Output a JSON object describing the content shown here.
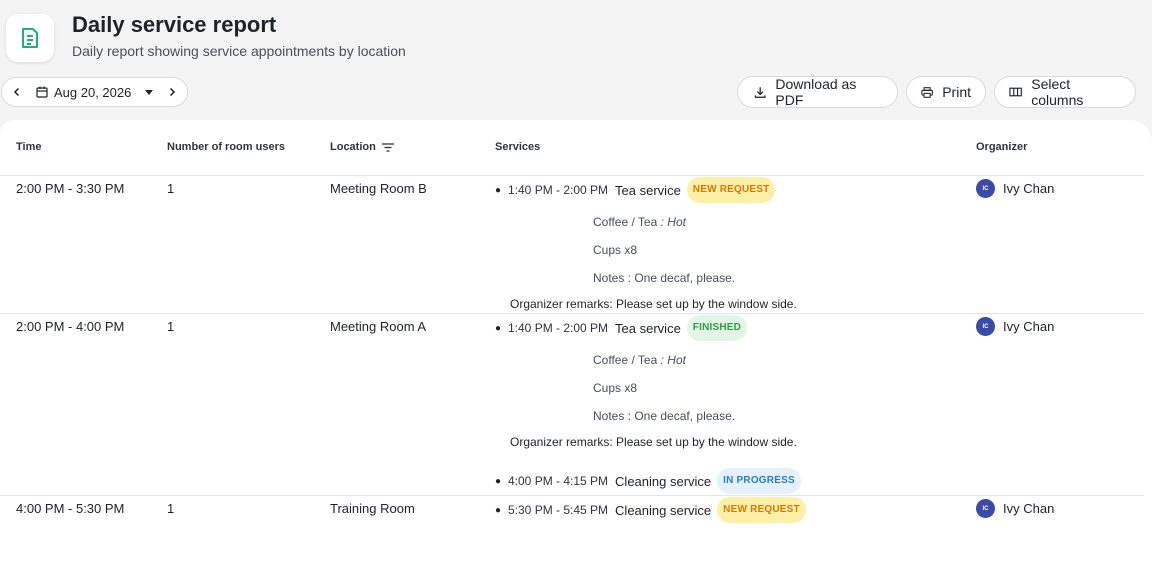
{
  "header": {
    "title": "Daily service report",
    "subtitle": "Daily report showing service appointments by location"
  },
  "date_nav": {
    "date": "Aug 20, 2026"
  },
  "toolbar": {
    "download_label": "Download as PDF",
    "print_label": "Print",
    "columns_label": "Select columns"
  },
  "columns": {
    "time": "Time",
    "users": "Number of room users",
    "location": "Location",
    "services": "Services",
    "organizer": "Organizer"
  },
  "rows": [
    {
      "time": "2:00 PM - 3:30 PM",
      "users": "1",
      "location": "Meeting Room B",
      "organizer": {
        "initials": "IC",
        "name": "Ivy Chan"
      },
      "services": [
        {
          "time": "1:40 PM - 2:00 PM",
          "name": "Tea service",
          "status": "NEW REQUEST",
          "details": {
            "coffee_label": "Coffee / Tea",
            "coffee_value": ": Hot",
            "cups": "Cups x8",
            "notes": "Notes : One decaf, please."
          },
          "remarks": "Organizer remarks: Please set up by the window side."
        }
      ]
    },
    {
      "time": "2:00 PM - 4:00 PM",
      "users": "1",
      "location": "Meeting Room A",
      "organizer": {
        "initials": "IC",
        "name": "Ivy Chan"
      },
      "services": [
        {
          "time": "1:40 PM - 2:00 PM",
          "name": "Tea service",
          "status": "FINISHED",
          "details": {
            "coffee_label": "Coffee / Tea",
            "coffee_value": ": Hot",
            "cups": "Cups x8",
            "notes": "Notes : One decaf, please."
          },
          "remarks": "Organizer remarks: Please set up by the window side."
        },
        {
          "time": "4:00 PM - 4:15 PM",
          "name": "Cleaning service",
          "status": "IN PROGRESS"
        }
      ]
    },
    {
      "time": "4:00 PM - 5:30 PM",
      "users": "1",
      "location": "Training Room",
      "organizer": {
        "initials": "IC",
        "name": "Ivy Chan"
      },
      "services": [
        {
          "time": "5:30 PM - 5:45 PM",
          "name": "Cleaning service",
          "status": "NEW REQUEST"
        }
      ]
    }
  ],
  "colors": {
    "new": "#d97706",
    "finished": "#2f9e44",
    "in_progress": "#2a7dc4",
    "avatar": "#3b4aa8"
  }
}
